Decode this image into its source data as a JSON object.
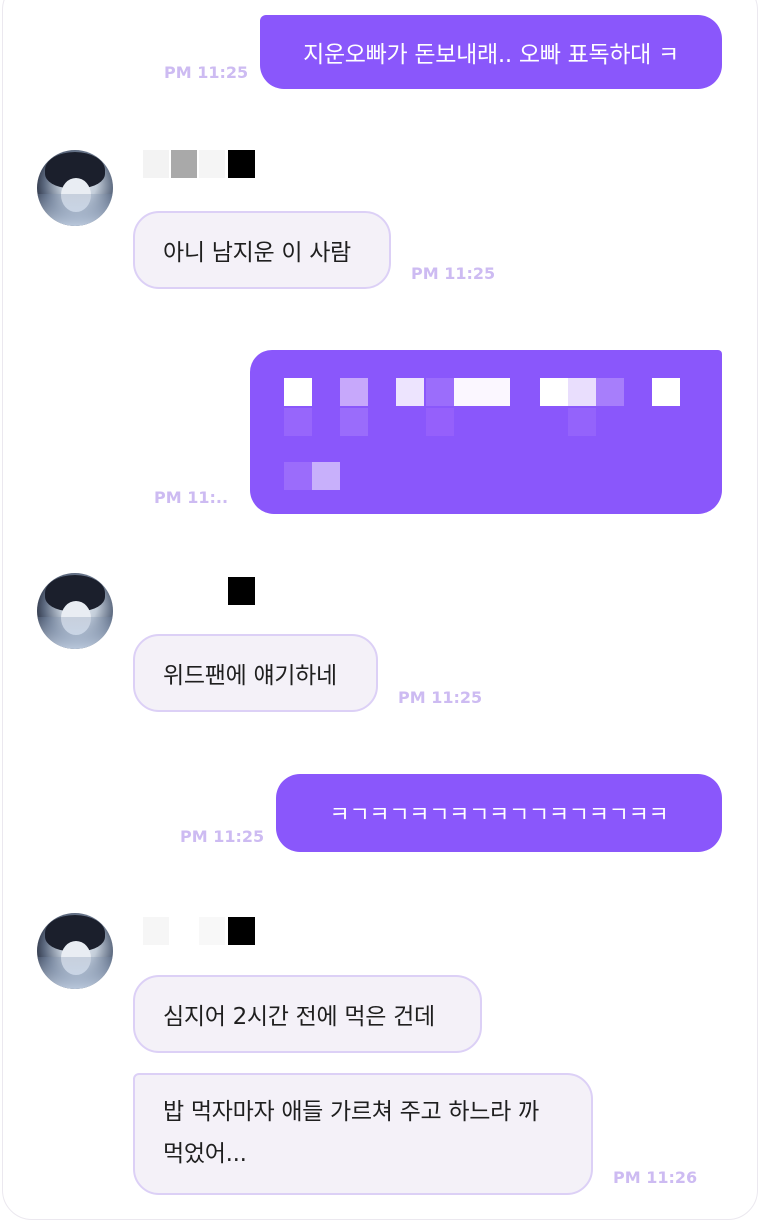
{
  "messages": {
    "m1": {
      "text": "지운오빠가 돈보내래.. 오빠 표독하대 ㅋ",
      "time": "PM 11:25"
    },
    "m2": {
      "text": "아니 남지운 이 사람",
      "time": "PM 11:25"
    },
    "m3": {
      "time": "PM 11:.."
    },
    "m4": {
      "text": "위드팬에 얘기하네",
      "time": "PM 11:25"
    },
    "m5": {
      "text": "ㅋㄱㅋㄱㅋㄱㅋㄱㅋㄱㄱㅋㄱㅋㄱㅋㅋ",
      "time": "PM 11:25"
    },
    "m6": {
      "text": "심지어 2시간 전에 먹은 건데"
    },
    "m7": {
      "line1": "밥 먹자마자 애들 가르쳐 주고 하느라 까",
      "line2": "먹었어...",
      "time": "PM 11:26"
    }
  },
  "colors": {
    "outgoing_bubble": "#8a57fb",
    "incoming_bubble": "#f4f1f8",
    "incoming_border": "#dcd0f6",
    "timestamp": "#cdbbf2"
  }
}
